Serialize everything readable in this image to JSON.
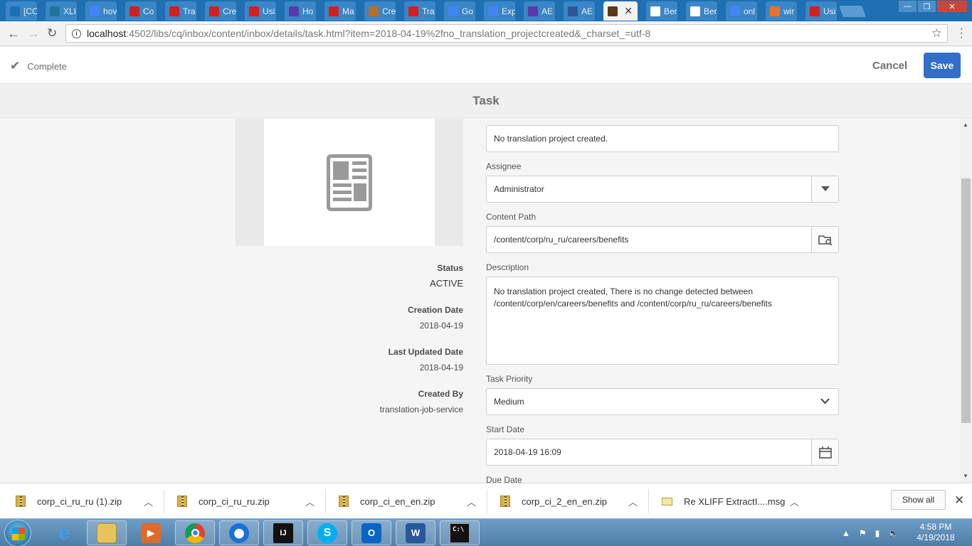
{
  "browser": {
    "tabs": [
      {
        "label": "[CC",
        "color": "#1f6fb3"
      },
      {
        "label": "XLI",
        "color": "#21759b"
      },
      {
        "label": "hov",
        "color": "#4285f4"
      },
      {
        "label": "Co",
        "color": "#d31f1f"
      },
      {
        "label": "Tra",
        "color": "#d31f1f"
      },
      {
        "label": "Cre",
        "color": "#d31f1f"
      },
      {
        "label": "Usi",
        "color": "#d31f1f"
      },
      {
        "label": "Ho",
        "color": "#5a3aa8"
      },
      {
        "label": "Ma",
        "color": "#d31f1f"
      },
      {
        "label": "Cre",
        "color": "#b76e28"
      },
      {
        "label": "Tra",
        "color": "#d31f1f"
      },
      {
        "label": "Go",
        "color": "#4285f4"
      },
      {
        "label": "Exp",
        "color": "#4285f4"
      },
      {
        "label": "AE",
        "color": "#5a3aa8"
      },
      {
        "label": "AE",
        "color": "#2b5797"
      },
      {
        "label": "",
        "color": "#5a3a1a",
        "active": true
      },
      {
        "label": "Ber",
        "color": "#ffffff"
      },
      {
        "label": "Ber",
        "color": "#ffffff"
      },
      {
        "label": "onl",
        "color": "#4285f4"
      },
      {
        "label": "wir",
        "color": "#e8742c"
      },
      {
        "label": "Usi",
        "color": "#d31f1f"
      }
    ],
    "url_host": "localhost",
    "url_rest": ":4502/libs/cq/inbox/content/inbox/details/task.html?item=2018-04-19%2fno_translation_projectcreated&_charset_=utf-8"
  },
  "header": {
    "complete_label": "Complete",
    "cancel_label": "Cancel",
    "save_label": "Save",
    "title": "Task"
  },
  "meta": {
    "status_label": "Status",
    "status_value": "ACTIVE",
    "creation_label": "Creation Date",
    "creation_value": "2018-04-19",
    "updated_label": "Last Updated Date",
    "updated_value": "2018-04-19",
    "created_by_label": "Created By",
    "created_by_value": "translation-job-service"
  },
  "form": {
    "title_value": "No translation project created.",
    "assignee_label": "Assignee",
    "assignee_value": "Administrator",
    "content_path_label": "Content Path",
    "content_path_value": "/content/corp/ru_ru/careers/benefits",
    "description_label": "Description",
    "description_value": "No translation project created, There is no change detected between /content/corp/en/careers/benefits and /content/corp/ru_ru/careers/benefits",
    "priority_label": "Task Priority",
    "priority_value": "Medium",
    "start_label": "Start Date",
    "start_value": "2018-04-19 16:09",
    "due_label": "Due Date"
  },
  "downloads": {
    "items": [
      "corp_ci_ru_ru (1).zip",
      "corp_ci_ru_ru.zip",
      "corp_ci_en_en.zip",
      "corp_ci_2_en_en.zip",
      "Re XLIFF ExtractI....msg"
    ],
    "show_all": "Show all"
  },
  "taskbar": {
    "time": "4:58 PM",
    "date": "4/19/2018"
  },
  "colors": {
    "accent": "#326ec8",
    "chrome_blue": "#1f6fb3"
  }
}
